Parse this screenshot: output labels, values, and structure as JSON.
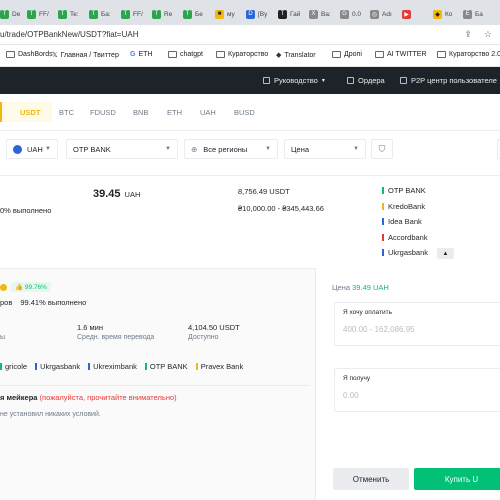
{
  "browser": {
    "tabs": [
      {
        "label": "De",
        "fav": "green",
        "glyph": "T"
      },
      {
        "label": "FF/",
        "fav": "green",
        "glyph": "T"
      },
      {
        "label": "Te:",
        "fav": "green",
        "glyph": "T"
      },
      {
        "label": "Ба:",
        "fav": "green",
        "glyph": "T"
      },
      {
        "label": "FF/",
        "fav": "green",
        "glyph": "T"
      },
      {
        "label": "Re",
        "fav": "green",
        "glyph": "T"
      },
      {
        "label": "Бе",
        "fav": "green",
        "glyph": "T"
      },
      {
        "label": "му",
        "fav": "yellow",
        "glyph": "■"
      },
      {
        "label": "[Ву",
        "fav": "blue",
        "glyph": "D"
      },
      {
        "label": "Гай",
        "fav": "black",
        "glyph": "T"
      },
      {
        "label": "Ва:",
        "fav": "grey",
        "glyph": "X"
      },
      {
        "label": "0.0",
        "fav": "grey",
        "glyph": "G"
      },
      {
        "label": "Adı",
        "fav": "grey",
        "glyph": "◎"
      },
      {
        "label": "",
        "fav": "red",
        "glyph": "▶"
      },
      {
        "label": "Ко",
        "fav": "yellow",
        "glyph": "◆"
      },
      {
        "label": "Ба",
        "fav": "grey",
        "glyph": "E"
      }
    ],
    "url": "u/trade/OTPBankNew/USDT?fiat=UAH",
    "bookmarks": [
      {
        "label": "DashBords",
        "icon": "folder-icon"
      },
      {
        "label": "Главная / Твиттер",
        "icon": "x-icon"
      },
      {
        "label": "ETH",
        "icon": "google-icon"
      },
      {
        "label": "chatgpt",
        "icon": "folder-icon"
      },
      {
        "label": "Кураторство",
        "icon": "folder-icon"
      },
      {
        "label": "Translator",
        "icon": "translator-icon"
      },
      {
        "label": "Дропі",
        "icon": "folder-icon"
      },
      {
        "label": "AI TWITTER",
        "icon": "folder-icon"
      },
      {
        "label": "Кураторство 2.0",
        "icon": "folder-icon"
      }
    ]
  },
  "header": {
    "guide": "Руководство",
    "orders": "Ордера",
    "p2p_center": "P2P центр пользователе"
  },
  "coins": {
    "items": [
      "USDT",
      "BTC",
      "FDUSD",
      "BNB",
      "ETH",
      "UAH",
      "BUSD"
    ],
    "active": "USDT"
  },
  "filters": {
    "fiat": "UAH",
    "payment": "OTP BANK",
    "region": "Все регионы",
    "sort": "Цена"
  },
  "ad": {
    "completion": "0% выполнено",
    "price": "39.45",
    "currency": "UAH",
    "available": "8,756.49 USDT",
    "limits": "₴10,000.00 - ₴345,443.66",
    "payments": [
      {
        "name": "OTP BANK",
        "color": "#02c076"
      },
      {
        "name": "KredoBank",
        "color": "#f0b90b"
      },
      {
        "name": "Idea Bank",
        "color": "#2b66d9"
      },
      {
        "name": "Accordbank",
        "color": "#e53935"
      },
      {
        "name": "Ukrgasbank",
        "color": "#2b66d9"
      }
    ]
  },
  "detail": {
    "rating_badge": "99.76%",
    "orders_label": "ров",
    "completion": "99.41% выполнено",
    "left_label": "ы",
    "time_value": "1.6 мин",
    "time_label": "Средн. время перевода",
    "available_value": "4,104.50 USDT",
    "available_label": "Доступно",
    "banks": [
      {
        "name": "gricole",
        "color": "#02c076"
      },
      {
        "name": "Ukrgasbank",
        "color": "#2b66d9"
      },
      {
        "name": "Ukreximbank",
        "color": "#2b66d9"
      },
      {
        "name": "OTP BANK",
        "color": "#02c076"
      },
      {
        "name": "Pravex Bank",
        "color": "#f0b90b"
      }
    ],
    "terms_title": "я мейкера",
    "terms_warning": "(пожалуйста, прочитайте внимательно)",
    "terms_text": "не установил никаких условий."
  },
  "order": {
    "price_label": "Цена",
    "price_value": "39.49 UAH",
    "pay_label": "Я хочу оплатить",
    "pay_placeholder": "400.00 - 162,086.95",
    "receive_label": "Я получу",
    "receive_placeholder": "0.00",
    "cancel": "Отменить",
    "buy": "Купить U"
  }
}
